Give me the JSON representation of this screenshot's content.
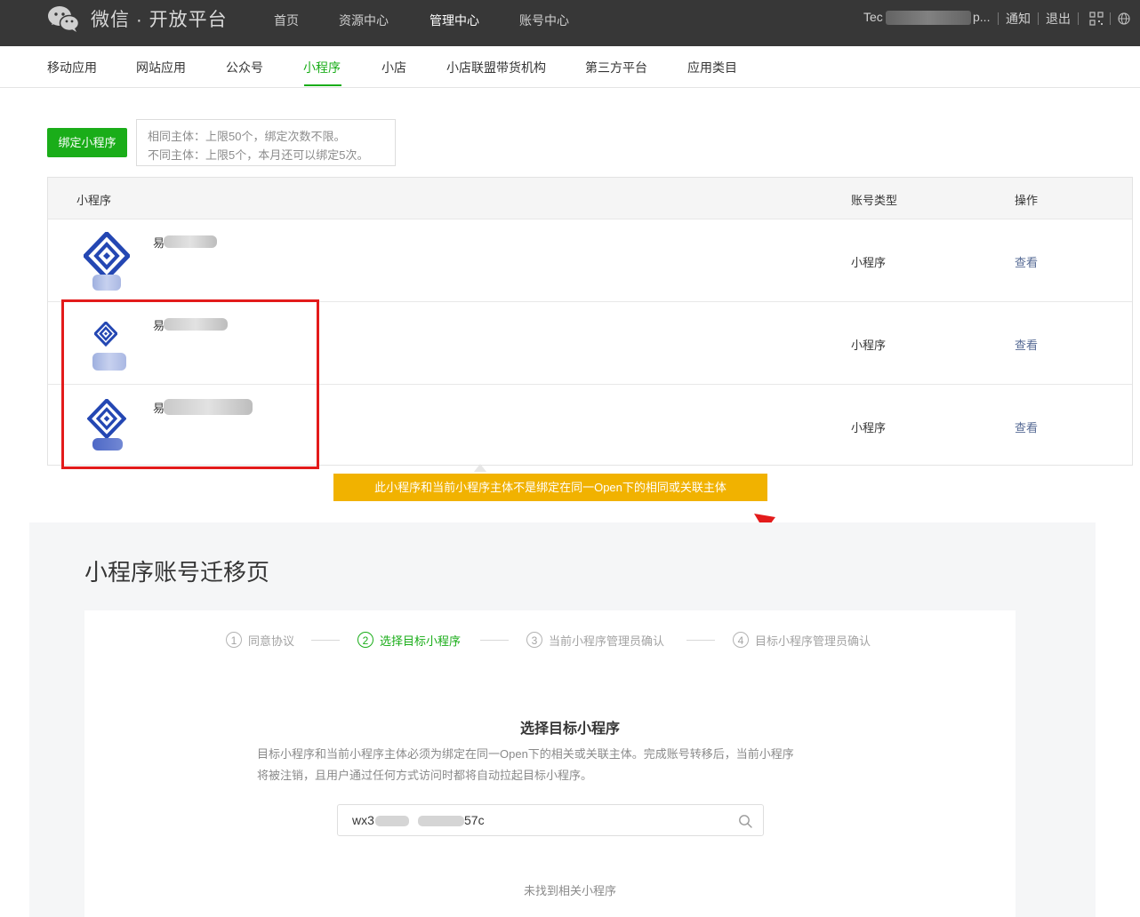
{
  "header": {
    "brand": "微信 · 开放平台",
    "nav": [
      "首页",
      "资源中心",
      "管理中心",
      "账号中心"
    ],
    "active_nav": "管理中心",
    "user_prefix": "Tec",
    "user_suffix": "p...",
    "notify": "通知",
    "logout": "退出",
    "icons": [
      "wechat-logo-icon",
      "qr-code-icon",
      "globe-icon"
    ]
  },
  "subnav": {
    "items": [
      "移动应用",
      "网站应用",
      "公众号",
      "小程序",
      "小店",
      "小店联盟带货机构",
      "第三方平台",
      "应用类目"
    ],
    "active": "小程序"
  },
  "bind": {
    "button": "绑定小程序",
    "tip_line1": "相同主体：上限50个，绑定次数不限。",
    "tip_line2": "不同主体：上限5个，本月还可以绑定5次。"
  },
  "table": {
    "headers": [
      "小程序",
      "账号类型",
      "操作"
    ],
    "rows": [
      {
        "name": "易",
        "type": "小程序",
        "action": "查看"
      },
      {
        "name": "易",
        "type": "小程序",
        "action": "查看"
      },
      {
        "name": "易",
        "type": "小程序",
        "action": "查看"
      }
    ]
  },
  "tooltip": "此小程序和当前小程序主体不是绑定在同一Open下的相同或关联主体",
  "migrate": {
    "title": "小程序账号迁移页",
    "steps": [
      {
        "num": "1",
        "label": "同意协议"
      },
      {
        "num": "2",
        "label": "选择目标小程序"
      },
      {
        "num": "3",
        "label": "当前小程序管理员确认"
      },
      {
        "num": "4",
        "label": "目标小程序管理员确认"
      }
    ],
    "active_step": 2,
    "select_title": "选择目标小程序",
    "select_desc_line1": "目标小程序和当前小程序主体必须为绑定在同一Open下的相关或关联主体。完成账号转移后，当前小程序",
    "select_desc_line2": "将被注销，且用户通过任何方式访问时都将自动拉起目标小程序。",
    "search_prefix": "wx3",
    "search_suffix": "57c",
    "empty": "未找到相关小程序"
  },
  "colors": {
    "topbar": "#373737",
    "accent_green": "#1aad19",
    "link": "#576b95",
    "tooltip_bg": "#f1b200",
    "highlight_red": "#e31b1b"
  }
}
